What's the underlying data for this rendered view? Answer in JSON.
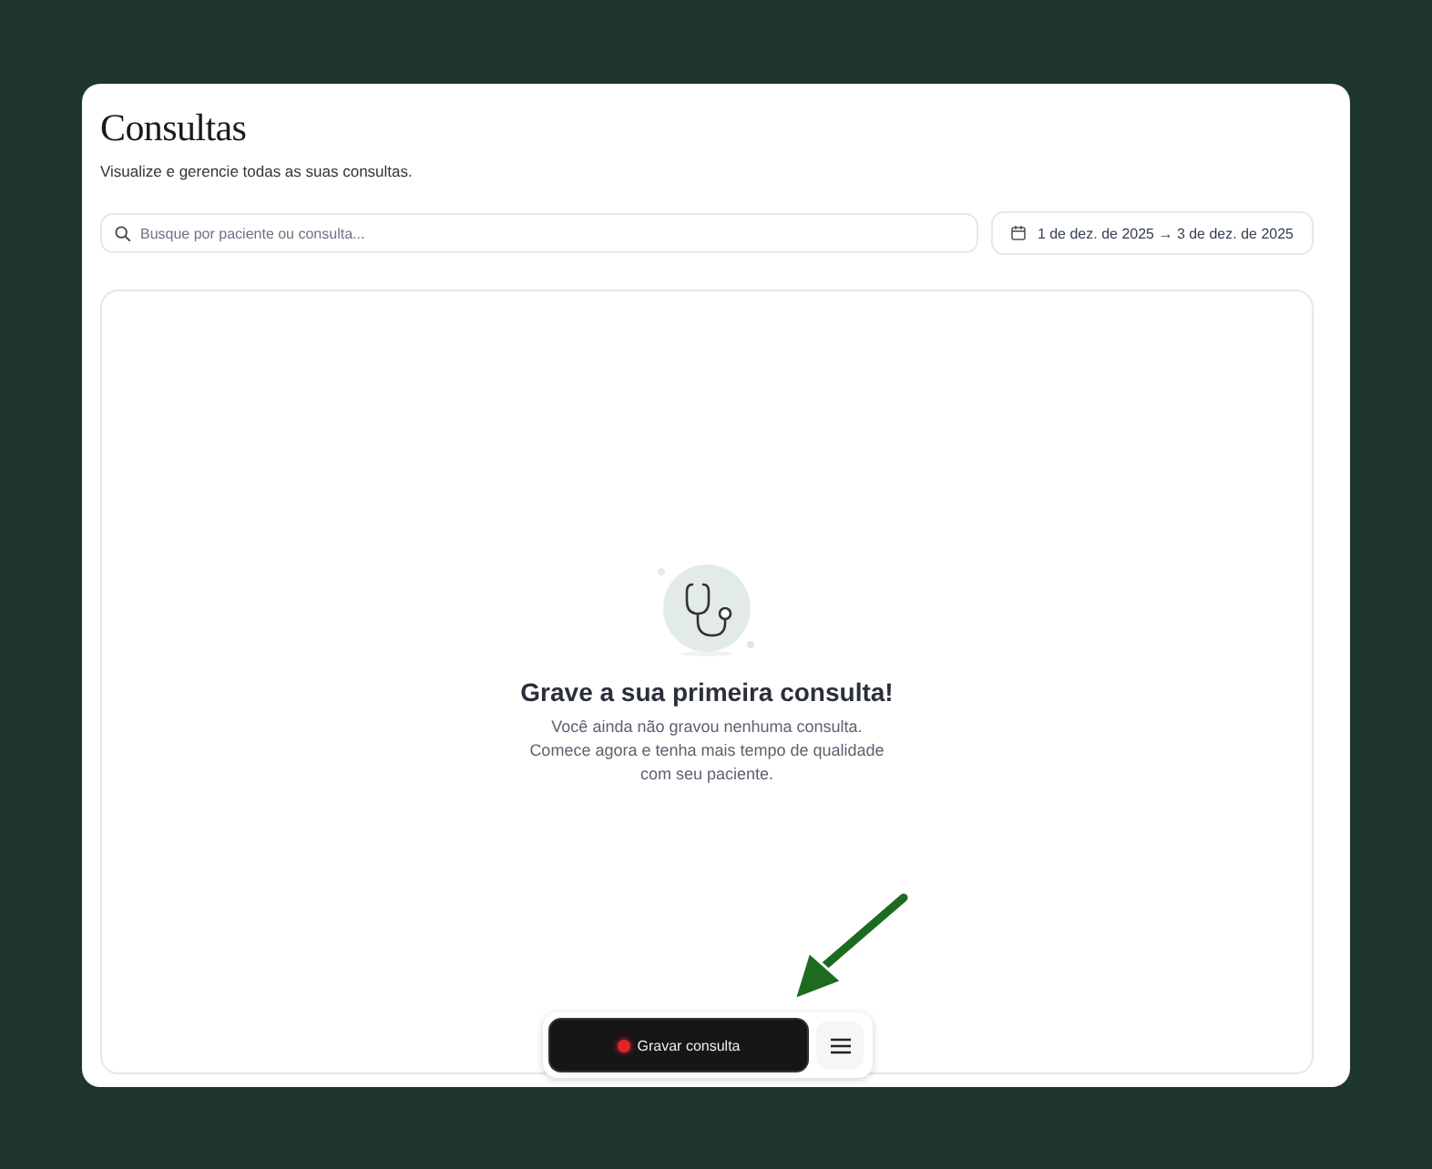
{
  "header": {
    "title": "Consultas",
    "subtitle": "Visualize e gerencie todas as suas consultas."
  },
  "search": {
    "placeholder": "Busque por paciente ou consulta..."
  },
  "date_range": {
    "label": "1 de dez. de 2025 → 3 de dez. de 2025"
  },
  "empty_state": {
    "title": "Grave a sua primeira consulta!",
    "lines": [
      "Você ainda não gravou nenhuma consulta.",
      "Comece agora e tenha mais tempo de qualidade",
      "com seu paciente."
    ]
  },
  "record_bar": {
    "button": "Gravar consulta"
  }
}
